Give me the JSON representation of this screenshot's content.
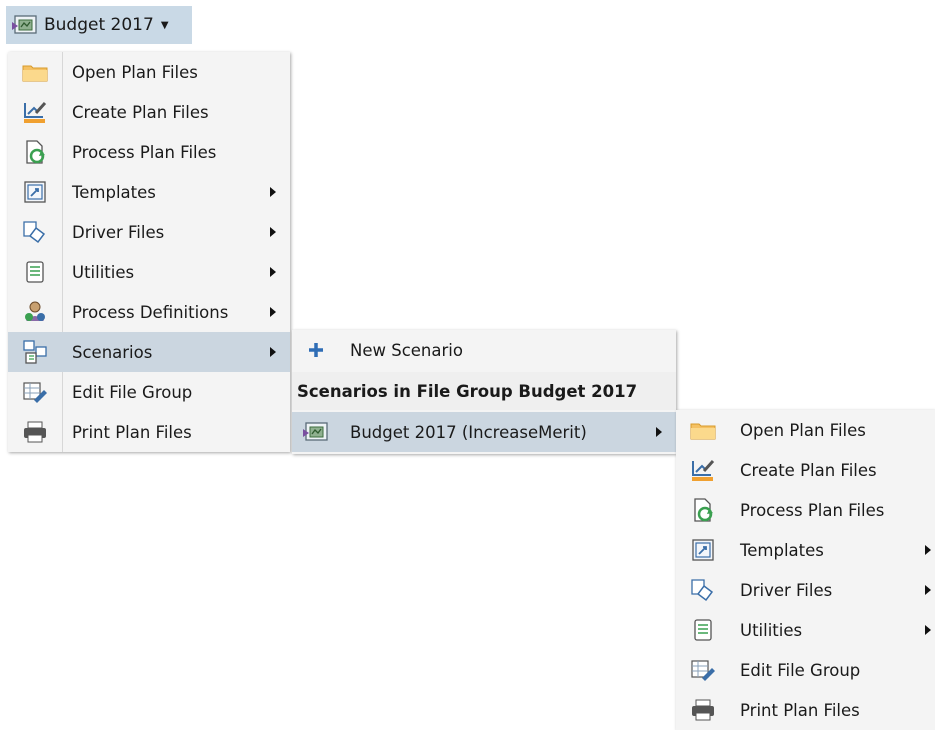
{
  "top_button": {
    "label": "Budget 2017",
    "icon": "file-group-icon"
  },
  "main_menu": {
    "items": [
      {
        "label": "Open Plan Files",
        "icon": "folder-icon",
        "submenu": false
      },
      {
        "label": "Create Plan Files",
        "icon": "create-plan-icon",
        "submenu": false
      },
      {
        "label": "Process Plan Files",
        "icon": "process-plan-icon",
        "submenu": false
      },
      {
        "label": "Templates",
        "icon": "templates-icon",
        "submenu": true
      },
      {
        "label": "Driver Files",
        "icon": "driver-files-icon",
        "submenu": true
      },
      {
        "label": "Utilities",
        "icon": "utilities-icon",
        "submenu": true
      },
      {
        "label": "Process Definitions",
        "icon": "process-definitions-icon",
        "submenu": true
      },
      {
        "label": "Scenarios",
        "icon": "scenarios-icon",
        "submenu": true,
        "active": true
      },
      {
        "label": "Edit File Group",
        "icon": "edit-file-group-icon",
        "submenu": false
      },
      {
        "label": "Print Plan Files",
        "icon": "printer-icon",
        "submenu": false
      }
    ]
  },
  "scenarios_menu": {
    "new_scenario": "New Scenario",
    "section_header": "Scenarios in File Group Budget 2017",
    "scenario_item": "Budget 2017 (IncreaseMerit)"
  },
  "scenario_submenu": {
    "items": [
      {
        "label": "Open Plan Files",
        "icon": "folder-icon"
      },
      {
        "label": "Create Plan Files",
        "icon": "create-plan-icon"
      },
      {
        "label": "Process Plan Files",
        "icon": "process-plan-icon"
      },
      {
        "label": "Templates",
        "icon": "templates-icon",
        "submenu": true
      },
      {
        "label": "Driver Files",
        "icon": "driver-files-icon",
        "submenu": true
      },
      {
        "label": "Utilities",
        "icon": "utilities-icon",
        "submenu": true
      },
      {
        "label": "Edit File Group",
        "icon": "edit-file-group-icon"
      },
      {
        "label": "Print Plan Files",
        "icon": "printer-icon"
      }
    ]
  },
  "colors": {
    "active_highlight": "#cbd6e0",
    "top_button_bg": "#c9d9e6",
    "menu_bg": "#f4f4f4"
  }
}
